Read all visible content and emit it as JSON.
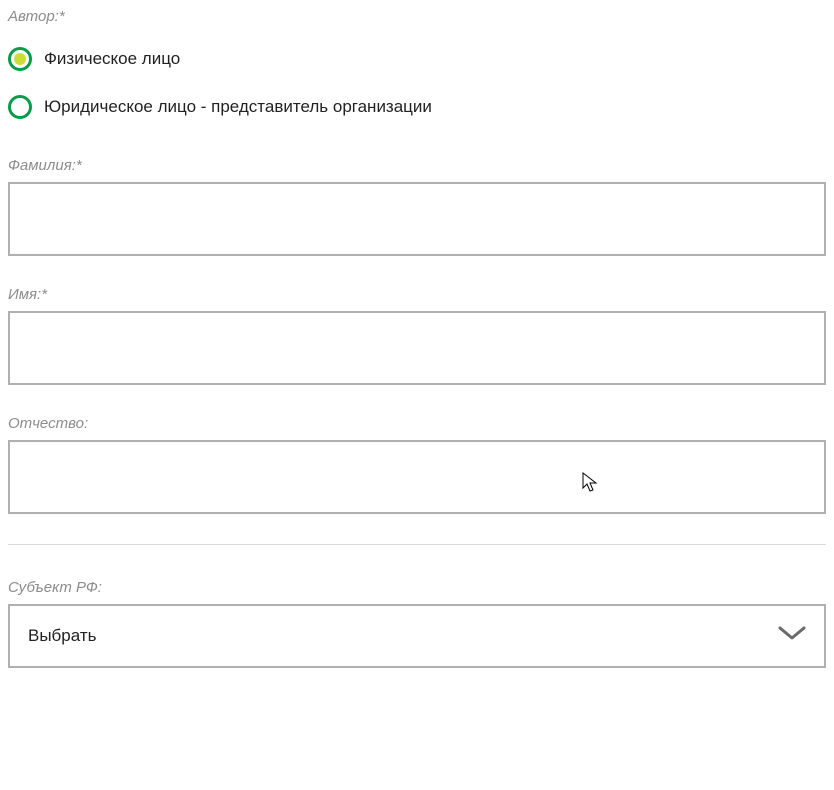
{
  "author": {
    "label": "Автор:*",
    "options": [
      {
        "label": "Физическое лицо",
        "selected": true
      },
      {
        "label": "Юридическое лицо - представитель организации",
        "selected": false
      }
    ]
  },
  "fields": {
    "surname": {
      "label": "Фамилия:*",
      "value": ""
    },
    "name": {
      "label": "Имя:*",
      "value": ""
    },
    "patronymic": {
      "label": "Отчество:",
      "value": ""
    }
  },
  "region": {
    "label": "Субъект РФ:",
    "selected": "Выбрать"
  }
}
